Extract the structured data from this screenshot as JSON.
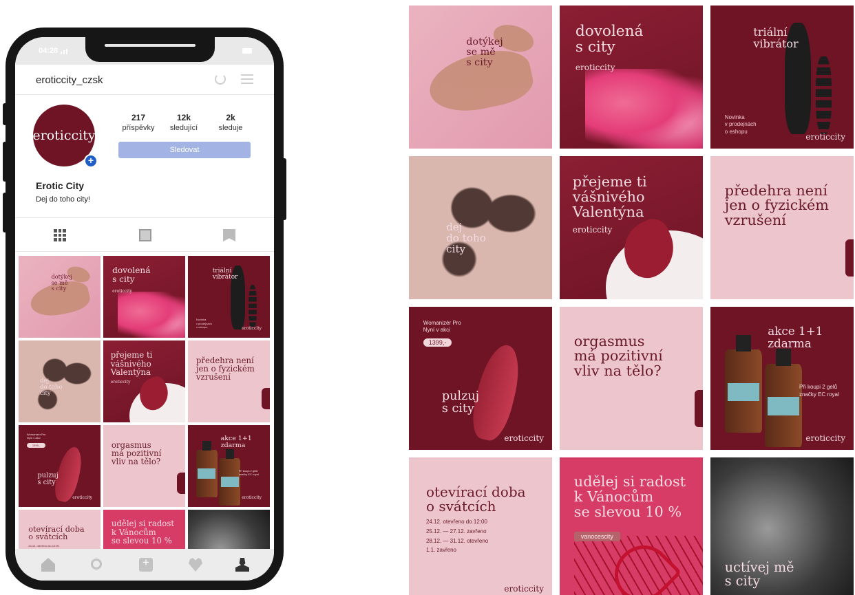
{
  "status": {
    "time": "04:28"
  },
  "profile": {
    "username": "eroticcity_czsk",
    "avatar_text": "eroticcity",
    "name": "Erotic City",
    "bio": "Dej do toho city!",
    "follow_label": "Sledovat",
    "stats": [
      {
        "value": "217",
        "label": "příspěvky"
      },
      {
        "value": "12k",
        "label": "sledující"
      },
      {
        "value": "2k",
        "label": "sleduje"
      }
    ]
  },
  "tabs": [
    "grid-icon",
    "feed-icon",
    "tagged-icon"
  ],
  "bottom_nav": [
    "home-icon",
    "search-icon",
    "add-icon",
    "heart-icon",
    "profile-icon"
  ],
  "colors": {
    "wine": "#6e1425",
    "blush": "#ecc6cc",
    "follow": "#a3b3e3",
    "accent_blue": "#1e5ec6"
  },
  "posts": [
    {
      "text": "dotýkej\nse mě\ns city"
    },
    {
      "text": "dovolená\ns city",
      "brand": "eroticcity"
    },
    {
      "text": "triální\nvibrátor",
      "note": "Novinka\nv prodejnách\no eshopu",
      "brand": "eroticcity"
    },
    {
      "text": "dej\ndo toho\ncity"
    },
    {
      "text": "přejeme ti\nvášnivého\nValentýna",
      "brand": "eroticcity"
    },
    {
      "text": "předehra není\njen o fyzickém\nvzrušení"
    },
    {
      "text": "pulzuj\ns city",
      "note": "Womanizér Pro\nNyní v akci",
      "price": "1399,-",
      "brand": "eroticcity"
    },
    {
      "text": "orgasmus\nmá pozitivní\nvliv na tělo?"
    },
    {
      "text": "akce 1+1\nzdarma",
      "note": "Při koupi 2 gelů\nznačky EC royal",
      "brand": "eroticcity"
    },
    {
      "text": "otevírací doba\no svátcích",
      "hours": [
        "24.12. otevřeno do 12:00",
        "25.12. — 27.12. zavřeno",
        "28.12. — 31.12. otevřeno",
        "1.1. zavřeno"
      ],
      "brand": "eroticcity"
    },
    {
      "text": "udělej si radost\nk Vánocům\nse slevou 10 %",
      "pill": "vanocescity"
    },
    {
      "text": "uctívej mě\ns city"
    }
  ]
}
